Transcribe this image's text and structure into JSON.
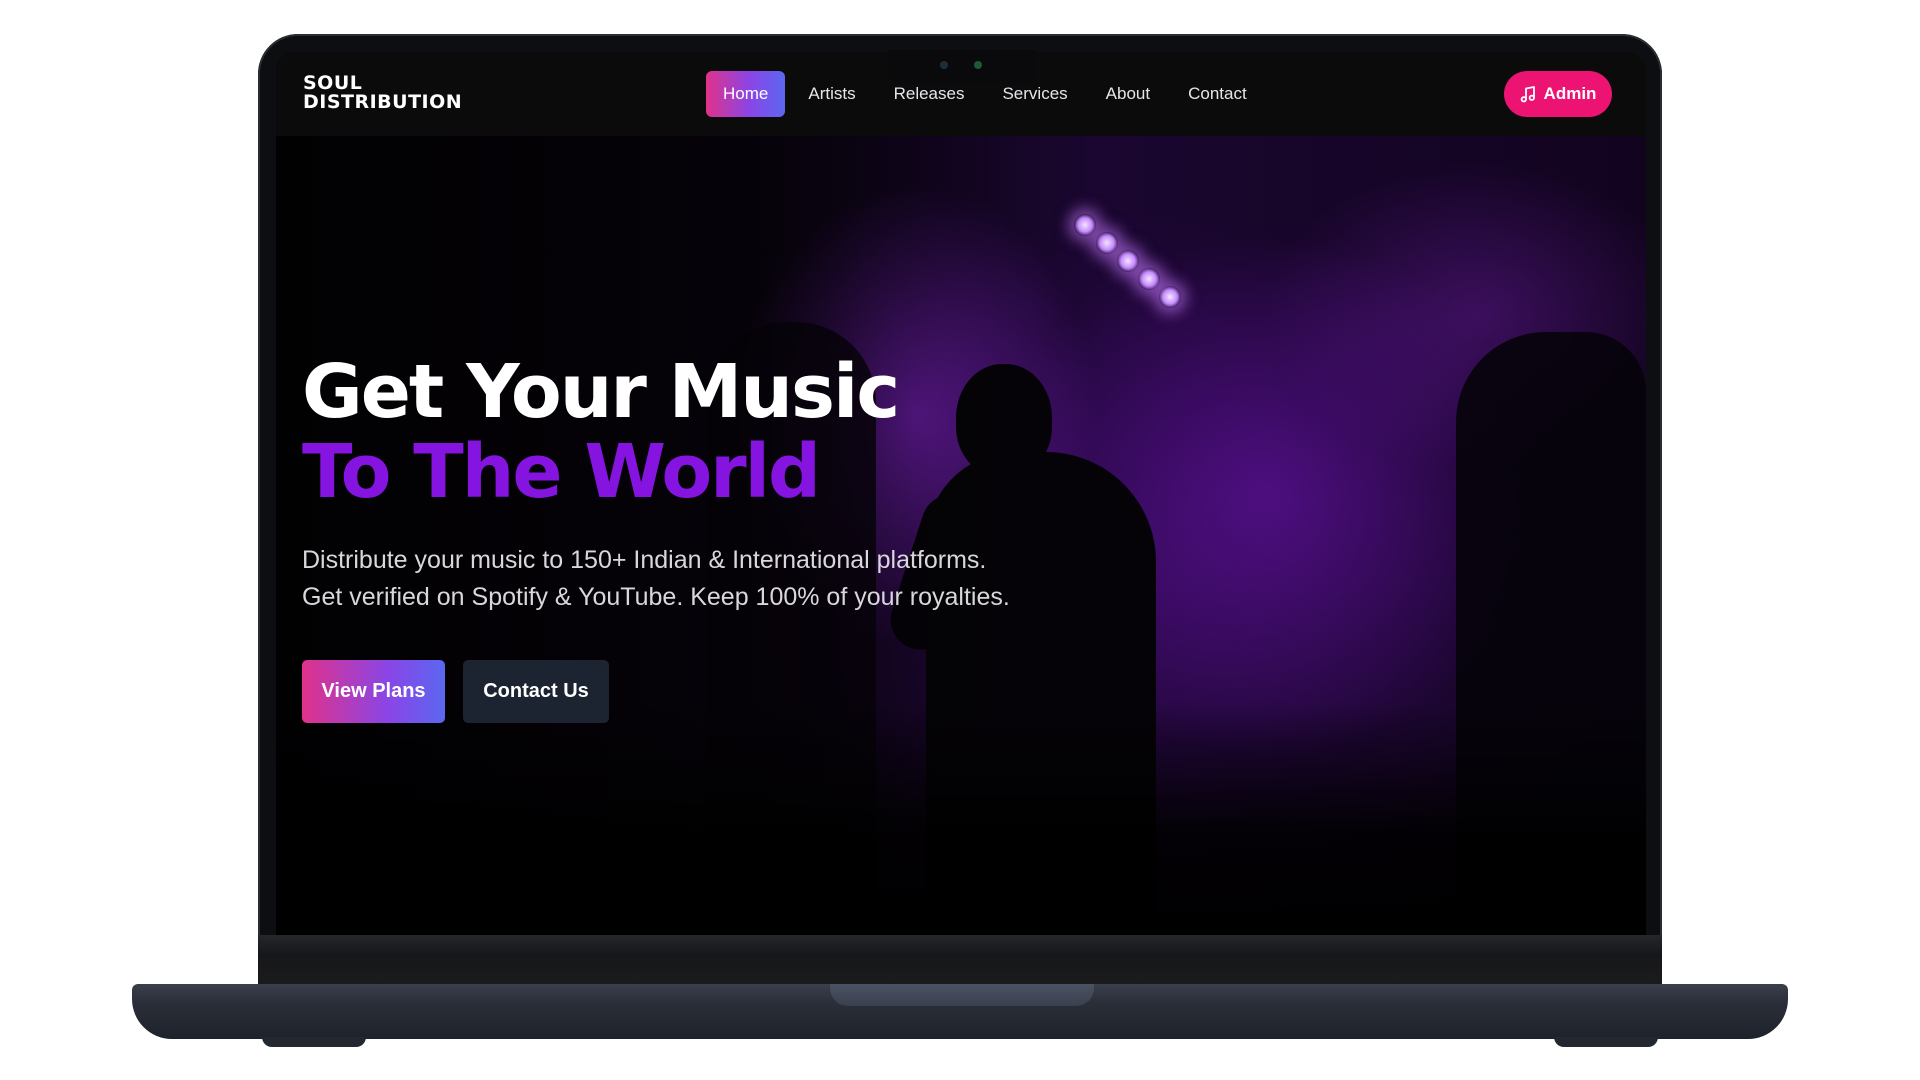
{
  "brand": {
    "line1": "SOUL",
    "line2": "DISTRIBUTION"
  },
  "nav": {
    "items": [
      {
        "label": "Home",
        "active": true
      },
      {
        "label": "Artists",
        "active": false
      },
      {
        "label": "Releases",
        "active": false
      },
      {
        "label": "Services",
        "active": false
      },
      {
        "label": "About",
        "active": false
      },
      {
        "label": "Contact",
        "active": false
      }
    ],
    "admin_label": "Admin",
    "admin_icon": "music-note-icon"
  },
  "hero": {
    "headline_line1": "Get Your Music",
    "headline_line2": "To The World",
    "subtext": "Distribute your music to 150+ Indian & International platforms. Get verified on Spotify & YouTube. Keep 100% of your royalties.",
    "primary_cta": "View Plans",
    "secondary_cta": "Contact Us"
  },
  "colors": {
    "accent_pink": "#ec1373",
    "accent_purple": "#8514e0",
    "gradient_start": "#e0328a",
    "gradient_end": "#5b67f0",
    "secondary_button": "#1c2331",
    "navbar_bg": "#0b0b0c"
  }
}
